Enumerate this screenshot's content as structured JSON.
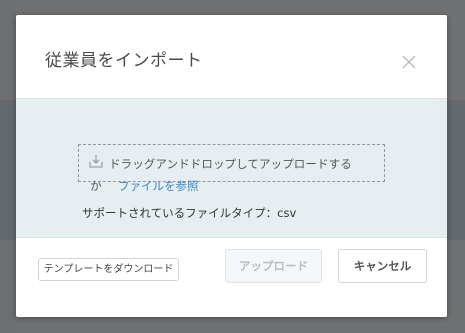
{
  "modal": {
    "title": "従業員をインポート",
    "close_icon": "close-icon"
  },
  "dropzone": {
    "icon": "download-tray-icon",
    "text": "ドラッグアンドドロップしてアップロードする",
    "text_tail": "か",
    "browse_link": "ファイルを参照"
  },
  "supported_types": "サポートされているファイルタイプ：csv",
  "footer": {
    "template_button": "テンプレートをダウンロード",
    "upload_button": "アップロード",
    "cancel_button": "キャンセル"
  },
  "colors": {
    "overlay": "#6f7172",
    "body_bg": "#e7eef2",
    "link": "#3b88c7",
    "disabled_text": "#b6bcc0"
  }
}
